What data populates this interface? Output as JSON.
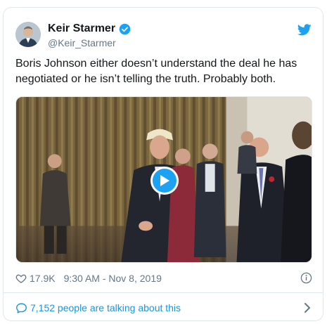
{
  "author": {
    "name": "Keir Starmer",
    "handle": "@Keir_Starmer",
    "verified": true
  },
  "tweet": {
    "text": "Boris Johnson either doesn’t understand the deal he has negotiated or he isn’t telling the truth. Probably both."
  },
  "media": {
    "type": "video"
  },
  "meta": {
    "likes": "17.9K",
    "timestamp": "9:30 AM - Nov 8, 2019"
  },
  "footer": {
    "talking": "7,152 people are talking about this"
  },
  "colors": {
    "accent": "#1da1f2",
    "link": "#1b95e0",
    "muted": "#657786"
  },
  "icons": {
    "verified": "verified-badge-icon",
    "brand": "twitter-bird-icon",
    "play": "play-icon",
    "like": "heart-icon",
    "info": "info-icon",
    "reply": "speech-bubble-icon",
    "chevron": "chevron-right-icon"
  }
}
